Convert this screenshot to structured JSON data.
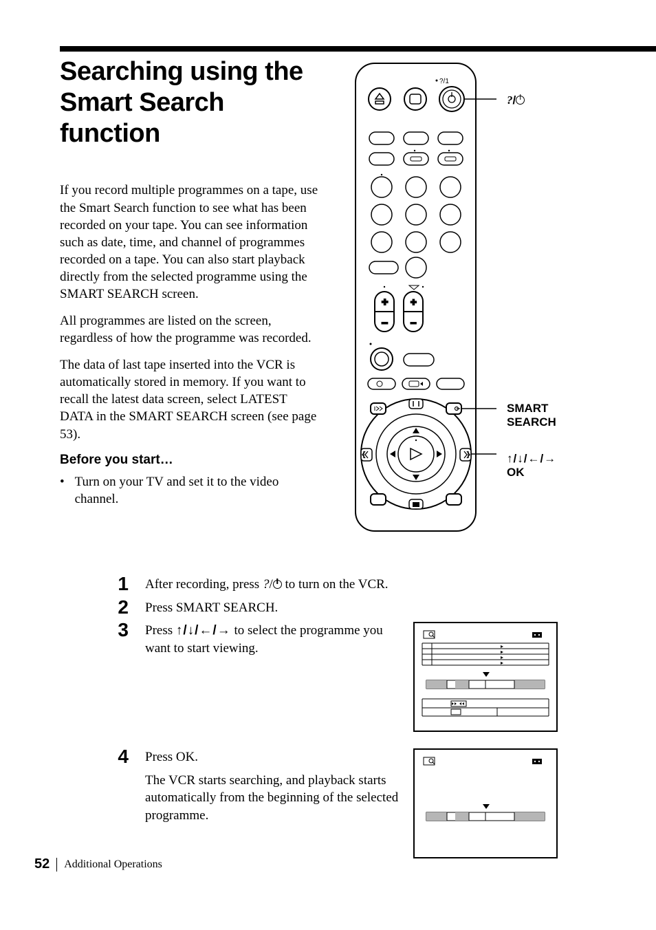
{
  "title": "Searching using the Smart Search function",
  "intro": {
    "p1": "If you record multiple programmes on a tape, use the Smart Search function to see what has been recorded on your tape.  You can see information such as date, time, and channel of programmes recorded on a tape.  You can also start playback directly from the selected programme using the SMART SEARCH screen.",
    "p2": "All programmes are listed on the screen, regardless of how the programme was recorded.",
    "p3": "The data of last tape inserted into the VCR is automatically stored in memory.  If you want to recall the latest data screen, select LATEST DATA in the SMART SEARCH screen (see page 53)."
  },
  "before_heading": "Before you start…",
  "bullet1": "Turn on your TV and set it to the video channel.",
  "callouts": {
    "power": "?/1",
    "smart": "SMART SEARCH",
    "arrows": "M/m/</,",
    "ok": "OK"
  },
  "steps": {
    "s1_a": "After recording, press  ",
    "s1_b": " to turn on the VCR.",
    "s1_mid": "/",
    "s2": "Press SMART SEARCH.",
    "s3_a": "Press ",
    "s3_b": " to select the programme you want to start viewing.",
    "s3_arrows": "M/m/</,",
    "s4_a": "Press OK.",
    "s4_b": "The VCR starts searching, and playback starts automatically from the beginning of the selected programme."
  },
  "footer": {
    "page": "52",
    "section": "Additional Operations"
  }
}
